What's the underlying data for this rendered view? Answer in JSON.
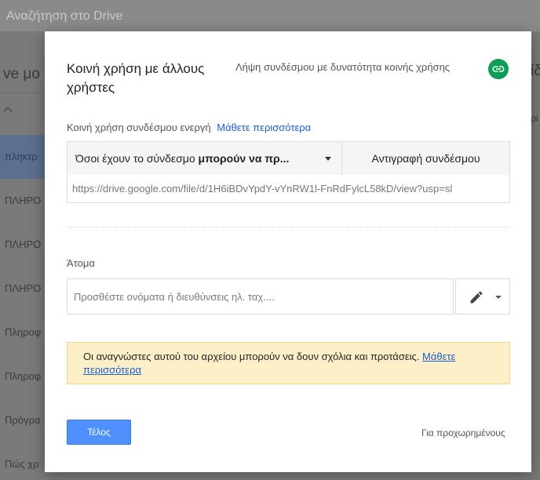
{
  "background": {
    "search_placeholder": "Αναζήτηση στο Drive",
    "heading_fragment": "ve μο",
    "heading_fragment_right": "ίδ",
    "column_fragment_right": "ρί",
    "rows": [
      "πληκτρ",
      "ΠΛΗΡΟ",
      "ΠΛΗΡΟ",
      "ΠΛΗΡΟ",
      "Πληροφ",
      "Πληροφ",
      "Πρόγρα",
      "Πώς χρ"
    ]
  },
  "dialog": {
    "title": "Κοινή χρήση με άλλους χρήστες",
    "get_link_label": "Λήψη συνδέσμου με δυνατότητα κοινής χρήσης",
    "link_sharing_status": "Κοινή χρήση συνδέσμου ενεργή",
    "learn_more": "Μάθετε περισσότερα",
    "permission_prefix": "Όσοι έχουν το σύνδεσμο ",
    "permission_bold": "μπορούν να πρ...",
    "copy_link_label": "Αντιγραφή συνδέσμου",
    "share_url": "https://drive.google.com/file/d/1H6iBDvYpdY-vYnRW1l-FnRdFylcL58kD/view?usp=sl",
    "people_label": "Άτομα",
    "people_placeholder": "Προσθέστε ονόματα ή διευθύνσεις ηλ. ταχ....",
    "notice_text": "Οι αναγνώστες αυτού του αρχείου μπορούν να δουν σχόλια και προτάσεις.",
    "notice_link": "Μάθετε περισσότερα",
    "done_label": "Τέλος",
    "advanced_label": "Για προχωρημένους"
  },
  "colors": {
    "accent_blue": "#4d90fe",
    "link_blue": "#1a5fd0",
    "link_icon_green": "#0f9d58",
    "notice_bg": "#fdf0c8"
  },
  "icons": {
    "link": "link-icon",
    "edit": "pencil-icon",
    "dropdown": "caret-down-icon"
  }
}
